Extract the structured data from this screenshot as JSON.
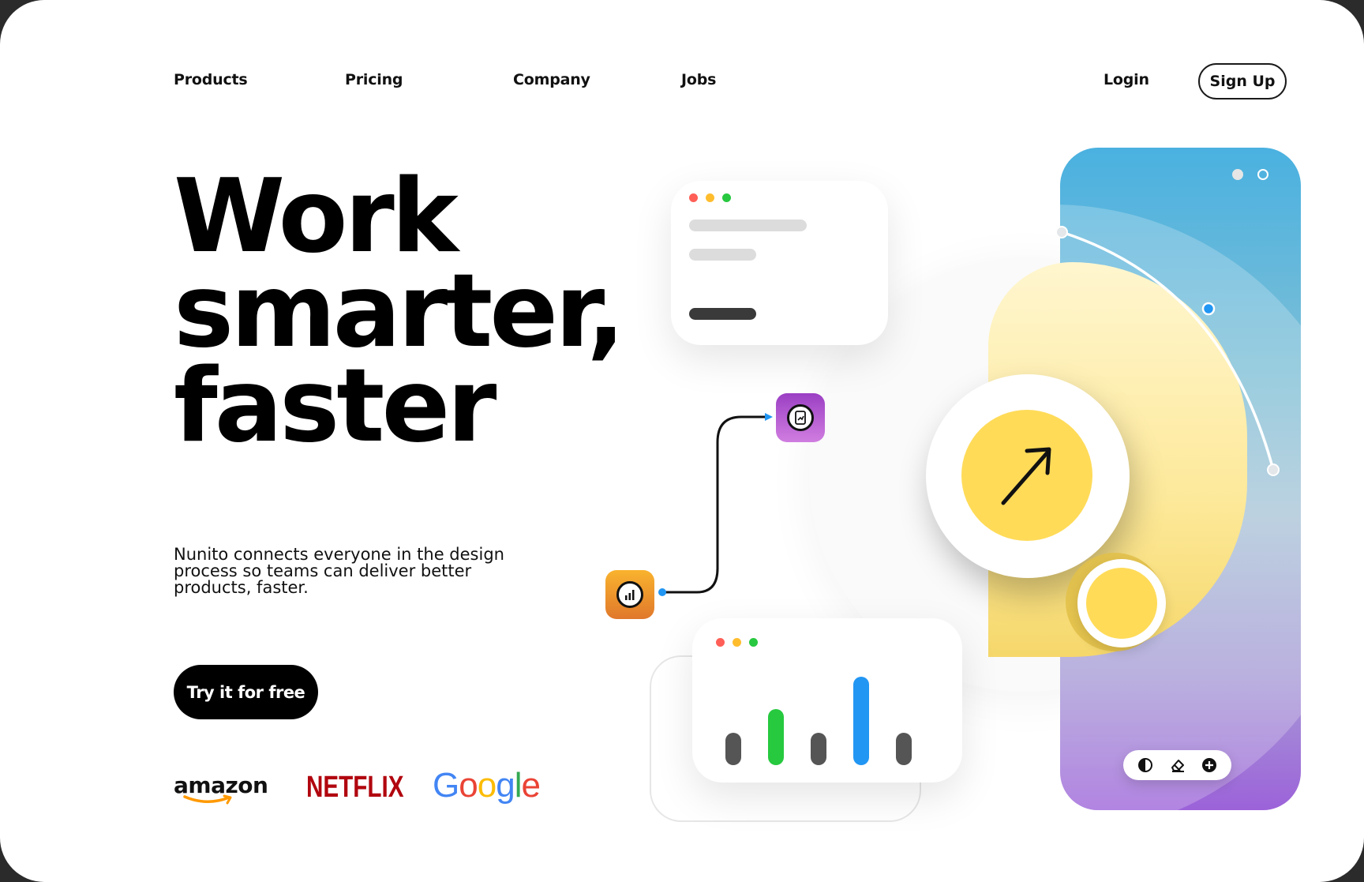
{
  "nav": {
    "products": "Products",
    "pricing": "Pricing",
    "company": "Company",
    "jobs": "Jobs",
    "login": "Login",
    "signup": "Sign Up"
  },
  "hero": {
    "title_line1": "Work",
    "title_line2": "smarter,",
    "title_line3": "faster",
    "description": "Nunito connects everyone in the design process so teams can deliver better products, faster.",
    "cta": "Try it for free"
  },
  "logos": {
    "amazon": "amazon",
    "netflix": "NETFLIX",
    "google": [
      "G",
      "o",
      "o",
      "g",
      "l",
      "e"
    ]
  },
  "colors": {
    "accent_yellow": "#ffdb58",
    "blue": "#2196f3",
    "green": "#27c93f",
    "gray_bar": "#555555",
    "window_red": "#ff5f57",
    "window_yellow": "#ffbd2e",
    "window_green": "#28c840",
    "google_blue": "#4285f4",
    "google_red": "#ea4335",
    "google_yellow": "#fbbc05",
    "google_green": "#34a853",
    "netflix_red": "#b1060f"
  },
  "icons": {
    "chart_app": "bar-chart-icon",
    "report_app": "report-icon",
    "arrow": "arrow-up-right-icon",
    "contrast": "contrast-icon",
    "eraser": "eraser-icon",
    "add": "plus-circle-icon"
  },
  "chart_data": {
    "type": "bar",
    "categories": [
      "",
      "",
      "",
      "",
      ""
    ],
    "values": [
      40,
      70,
      40,
      110,
      40
    ],
    "bar_colors": [
      "#555555",
      "#27c93f",
      "#555555",
      "#2196f3",
      "#555555"
    ],
    "ylim": [
      0,
      120
    ]
  }
}
